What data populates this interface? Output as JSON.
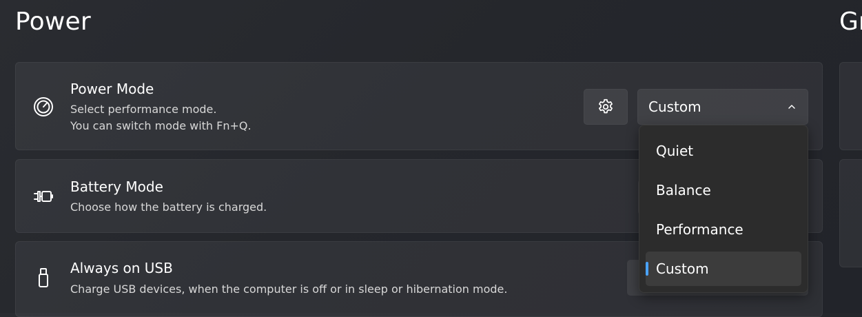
{
  "section": {
    "title": "Power",
    "right_title": "Gr"
  },
  "power_mode": {
    "icon": "speedometer-icon",
    "title": "Power Mode",
    "desc_line1": "Select performance mode.",
    "desc_line2": "You can switch mode with Fn+Q.",
    "settings_icon": "gear-icon",
    "selected": "Custom",
    "options": [
      "Quiet",
      "Balance",
      "Performance",
      "Custom"
    ]
  },
  "battery_mode": {
    "icon": "battery-plug-icon",
    "title": "Battery Mode",
    "desc": "Choose how the battery is charged."
  },
  "always_on_usb": {
    "icon": "usb-icon",
    "title": "Always on USB",
    "desc": "Charge USB devices, when the computer is off or in sleep or hibernation mode."
  },
  "colors": {
    "accent": "#4aa3ff",
    "card": "#33353a",
    "dropdown": "#2c2c2c"
  }
}
